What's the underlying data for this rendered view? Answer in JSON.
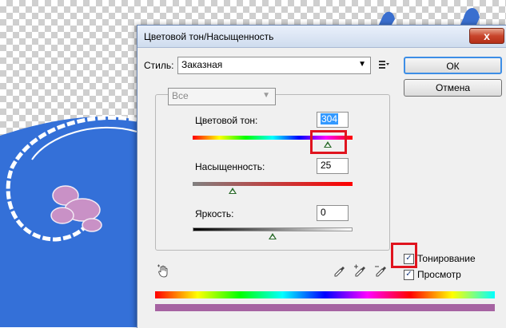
{
  "dialog": {
    "title": "Цветовой тон/Насыщенность",
    "close_label": "x"
  },
  "style": {
    "label": "Стиль:",
    "value": "Заказная"
  },
  "buttons": {
    "ok": "ОК",
    "cancel": "Отмена"
  },
  "channel": {
    "value": "Все"
  },
  "hue": {
    "label": "Цветовой тон:",
    "value": "304"
  },
  "saturation": {
    "label": "Насыщенность:",
    "value": "25"
  },
  "brightness": {
    "label": "Яркость:",
    "value": "0"
  },
  "options": {
    "colorize_label": "Тонирование",
    "colorize_checked": true,
    "preview_label": "Просмотр",
    "preview_checked": true
  },
  "colors": {
    "canvas_blue": "#3470d8",
    "result_bar": "#a663a2",
    "highlight": "#e0141e",
    "ok_focus": "#3d8ee6"
  },
  "icons": {
    "menu": "list-menu-icon",
    "hand": "hand-adjust-icon",
    "droppers": [
      "eyedropper-icon",
      "eyedropper-plus-icon",
      "eyedropper-minus-icon"
    ]
  }
}
